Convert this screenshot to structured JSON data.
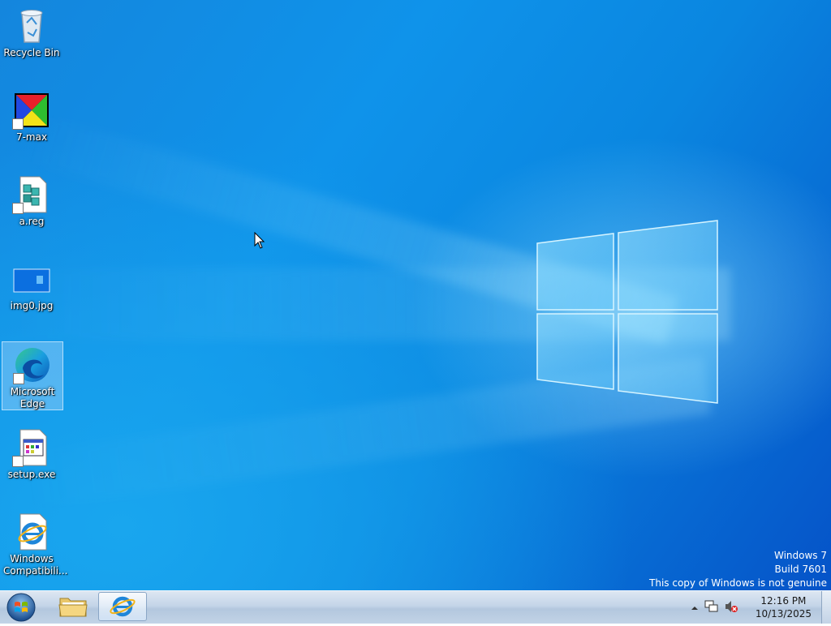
{
  "desktop": {
    "icons": [
      {
        "label": "Recycle Bin",
        "icon": "recycle-bin-icon"
      },
      {
        "label": "7-max",
        "icon": "7-max-icon"
      },
      {
        "label": "a.reg",
        "icon": "registry-file-icon"
      },
      {
        "label": "img0.jpg",
        "icon": "image-file-icon"
      },
      {
        "label": "Microsoft Edge",
        "icon": "edge-icon"
      },
      {
        "label": "setup.exe",
        "icon": "setup-exe-icon"
      },
      {
        "label": "Windows Compatibili...",
        "icon": "internet-explorer-icon"
      }
    ],
    "watermark": {
      "line1": "Windows 7",
      "line2": "Build 7601",
      "line3": "This copy of Windows is not genuine"
    }
  },
  "taskbar": {
    "start_icon": "start-orb-icon",
    "pinned": [
      {
        "name": "file-explorer",
        "icon": "folder-icon"
      },
      {
        "name": "internet-explorer",
        "icon": "internet-explorer-icon",
        "active": true
      }
    ],
    "tray": {
      "icons": [
        "show-hidden-icons-icon",
        "network-icon",
        "volume-muted-icon"
      ],
      "time": "12:16 PM",
      "date": "10/13/2025"
    }
  },
  "colors": {
    "desktop_blue": "#0f93ea",
    "taskbar": "#c4d5e8"
  }
}
